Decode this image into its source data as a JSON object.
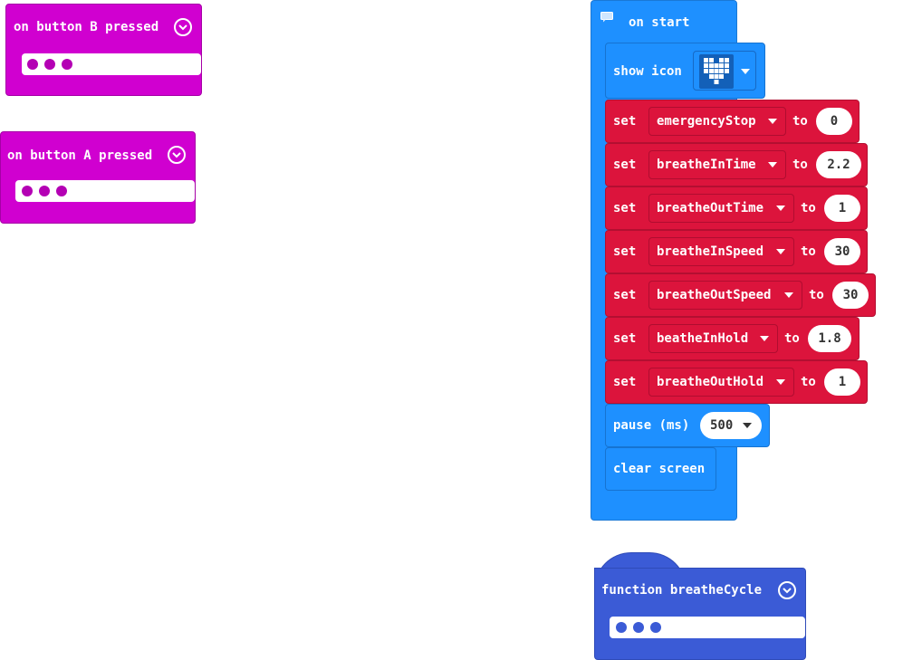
{
  "on_button_b": {
    "label": "on button B pressed"
  },
  "on_button_a": {
    "label": "on button A pressed"
  },
  "on_start": {
    "label": "on start",
    "show_icon": {
      "label": "show icon",
      "icon": "heart-icon"
    },
    "set_blocks": [
      {
        "set": "set",
        "variable": "emergencyStop",
        "to": "to",
        "value": "0"
      },
      {
        "set": "set",
        "variable": "breatheInTime",
        "to": "to",
        "value": "2.2"
      },
      {
        "set": "set",
        "variable": "breatheOutTime",
        "to": "to",
        "value": "1"
      },
      {
        "set": "set",
        "variable": "breatheInSpeed",
        "to": "to",
        "value": "30"
      },
      {
        "set": "set",
        "variable": "breatheOutSpeed",
        "to": "to",
        "value": "30"
      },
      {
        "set": "set",
        "variable": "beatheInHold",
        "to": "to",
        "value": "1.8"
      },
      {
        "set": "set",
        "variable": "breatheOutHold",
        "to": "to",
        "value": "1"
      }
    ],
    "pause": {
      "label": "pause (ms)",
      "value": "500"
    },
    "clear_screen": {
      "label": "clear screen"
    }
  },
  "function_block": {
    "label": "function breatheCycle"
  },
  "colors": {
    "input_events": "#d000d0",
    "basic": "#1e90ff",
    "variables": "#dc143c",
    "functions": "#3b5bd6"
  }
}
